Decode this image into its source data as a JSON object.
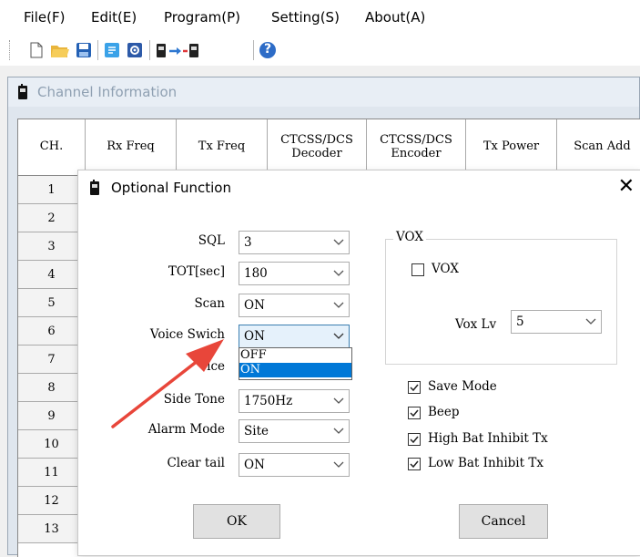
{
  "menu": [
    "File(F)",
    "Edit(E)",
    "Program(P)",
    "Setting(S)",
    "About(A)"
  ],
  "toolbar": {
    "icons": [
      "new-file-icon",
      "open-folder-icon",
      "save-icon",
      "read-icon",
      "settings-icon",
      "radio-transfer-icon",
      "help-icon"
    ],
    "help_glyph": "?"
  },
  "channel_window": {
    "title": "Channel Information",
    "columns": [
      "CH.",
      "Rx Freq",
      "Tx Freq",
      "CTCSS/DCS\nDecoder",
      "CTCSS/DCS\nEncoder",
      "Tx Power",
      "Scan Add"
    ],
    "rows": [
      "1",
      "2",
      "3",
      "4",
      "5",
      "6",
      "7",
      "8",
      "9",
      "10",
      "11",
      "12",
      "13"
    ]
  },
  "dialog": {
    "title": "Optional Function",
    "close": "✕",
    "fields": [
      {
        "label": "SQL",
        "value": "3"
      },
      {
        "label": "TOT[sec]",
        "value": "180"
      },
      {
        "label": "Scan",
        "value": "ON"
      },
      {
        "label": "Voice Swich",
        "value": "ON"
      },
      {
        "label": "ice",
        "value": ""
      },
      {
        "label": "Side Tone",
        "value": "1750Hz"
      },
      {
        "label": "Alarm Mode",
        "value": "Site"
      },
      {
        "label": "Clear tail",
        "value": "ON"
      }
    ],
    "voice_dropdown": {
      "options": [
        "OFF",
        "ON"
      ],
      "selected": "ON"
    },
    "vox_group": {
      "title": "VOX",
      "vox_checkbox": {
        "label": "VOX",
        "checked": false
      },
      "vox_level": {
        "label": "Vox Lv",
        "value": "5"
      }
    },
    "checkboxes": [
      {
        "label": "Save Mode",
        "checked": true
      },
      {
        "label": "Beep",
        "checked": true
      },
      {
        "label": "High Bat Inhibit Tx",
        "checked": true
      },
      {
        "label": "Low Bat Inhibit Tx",
        "checked": true
      }
    ],
    "ok": "OK",
    "cancel": "Cancel"
  },
  "colors": {
    "accent": "#0078d7",
    "arrow": "#e8463a",
    "highlight_bg": "#e5f1fb"
  }
}
